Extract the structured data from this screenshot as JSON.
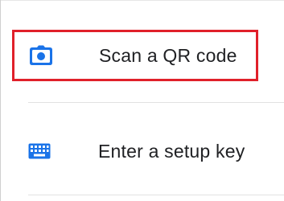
{
  "menu": {
    "items": [
      {
        "label": "Scan a QR code",
        "icon": "camera-icon",
        "highlighted": true
      },
      {
        "label": "Enter a setup key",
        "icon": "keyboard-icon",
        "highlighted": false
      }
    ]
  },
  "colors": {
    "accent": "#1a73e8",
    "highlight_border": "#e0202a",
    "text": "#202124",
    "divider": "#e2e2e2"
  }
}
